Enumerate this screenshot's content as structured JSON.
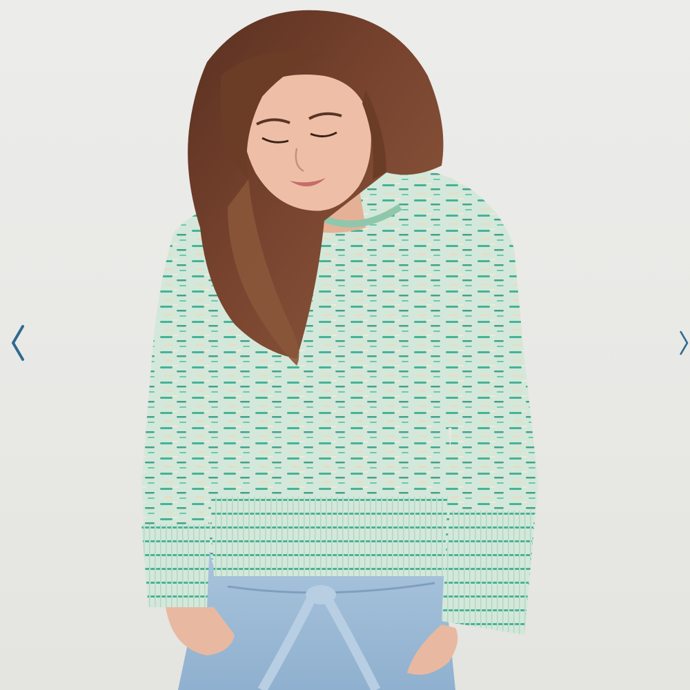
{
  "viewer": {
    "accent_color": "#2e6b8f",
    "prev_icon": "chevron-left-icon",
    "next_icon": "chevron-right-icon"
  },
  "photo": {
    "subject": "product-photo",
    "background_color": "#ebebe8",
    "sweater_color": "#cfe6d6",
    "fleck_color": "#2fa88a",
    "denim_color": "#9fbcd6",
    "hair_color": "#6b3d27",
    "skin_color": "#e8b9a0"
  }
}
